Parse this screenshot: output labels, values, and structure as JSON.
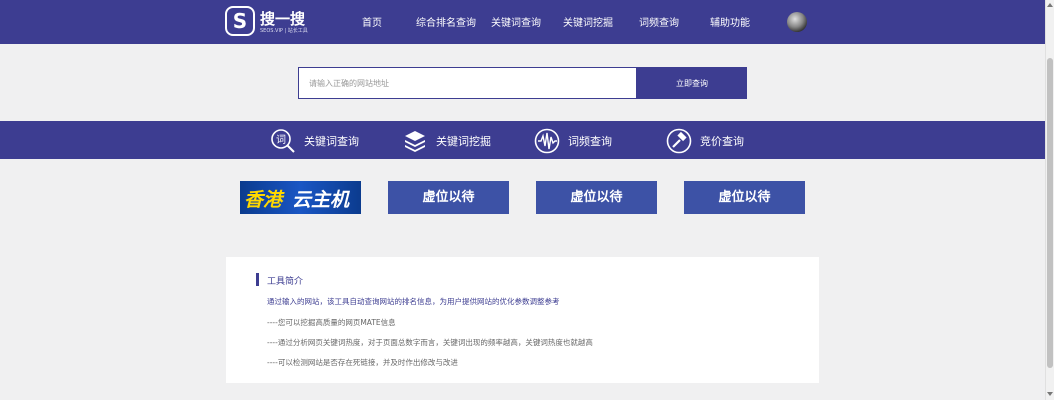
{
  "header": {
    "logo_badge": "S",
    "logo_name": "搜一搜",
    "logo_sub": "SEOS.VIP | 站长工具",
    "menu": [
      {
        "label": "首页"
      },
      {
        "label": "综合排名查询"
      },
      {
        "label": "关键词查询"
      },
      {
        "label": "关键词挖掘"
      },
      {
        "label": "词频查询"
      },
      {
        "label": "辅助功能"
      }
    ]
  },
  "search": {
    "placeholder": "请输入正确的网站地址",
    "value": "",
    "button_label": "立即查询"
  },
  "tools": [
    {
      "label": "关键词查询",
      "icon": "magnifier-char-icon"
    },
    {
      "label": "关键词挖掘",
      "icon": "layers-stack-icon"
    },
    {
      "label": "词频查询",
      "icon": "waveform-icon"
    },
    {
      "label": "竞价查询",
      "icon": "gavel-icon"
    }
  ],
  "banners": {
    "ad_left": "香港",
    "ad_right": "云主机",
    "placeholder_label": "虚位以待"
  },
  "intro": {
    "title": "工具简介",
    "lead": "通过输入的网站，该工具自动查询网站的排名信息，为用户提供网站的优化参数调整参考",
    "lines": [
      "----您可以挖掘高质量的网页MATE信息",
      "----通过分析网页关键词热度，对于页面总数字而言，关键词出现的频率越高，关键词热度也就越高",
      "----可以检测网站是否存在死链接，并及时作出修改与改进"
    ]
  },
  "colors": {
    "brand": "#3d3d91",
    "banner_blue": "#3d52a6",
    "page_bg": "#f0f0f1"
  }
}
